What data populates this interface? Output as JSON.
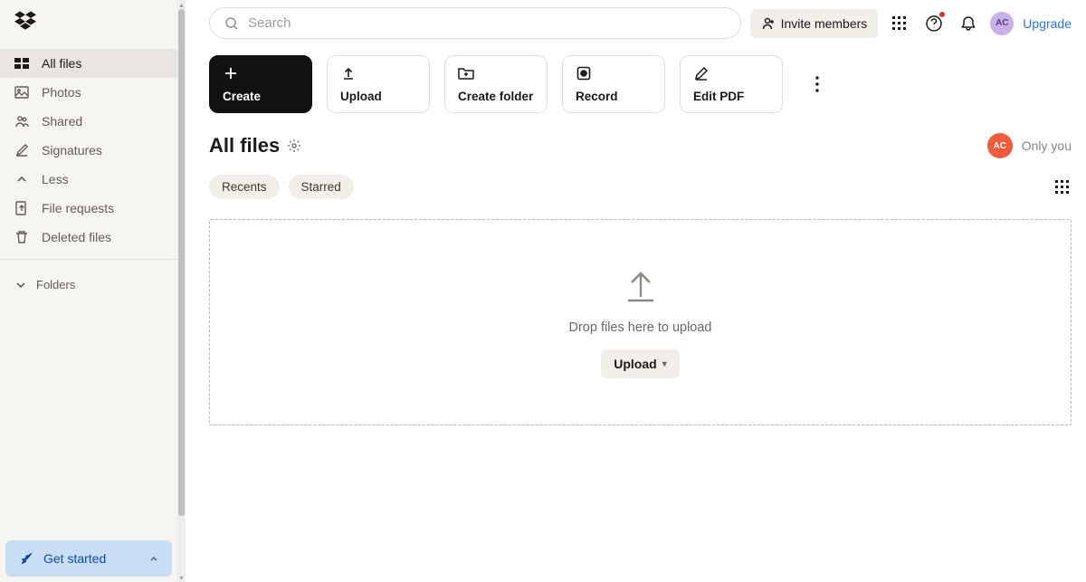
{
  "header": {
    "search_placeholder": "Search",
    "invite_label": "Invite members",
    "upgrade_label": "Upgrade",
    "avatar_initials": "AC"
  },
  "sidebar": {
    "items": [
      {
        "label": "All files",
        "icon": "files"
      },
      {
        "label": "Photos",
        "icon": "photo"
      },
      {
        "label": "Shared",
        "icon": "shared"
      },
      {
        "label": "Signatures",
        "icon": "signature"
      },
      {
        "label": "Less",
        "icon": "chevron"
      },
      {
        "label": "File requests",
        "icon": "file-request"
      },
      {
        "label": "Deleted files",
        "icon": "trash"
      }
    ],
    "folders_label": "Folders",
    "get_started_label": "Get started"
  },
  "actions": {
    "create": "Create",
    "upload": "Upload",
    "create_folder": "Create folder",
    "record": "Record",
    "edit_pdf": "Edit PDF"
  },
  "page": {
    "title": "All files",
    "only_you": "Only you",
    "avatar_initials": "AC"
  },
  "filters": {
    "recents": "Recents",
    "starred": "Starred"
  },
  "dropzone": {
    "hint": "Drop files here to upload",
    "button": "Upload"
  }
}
